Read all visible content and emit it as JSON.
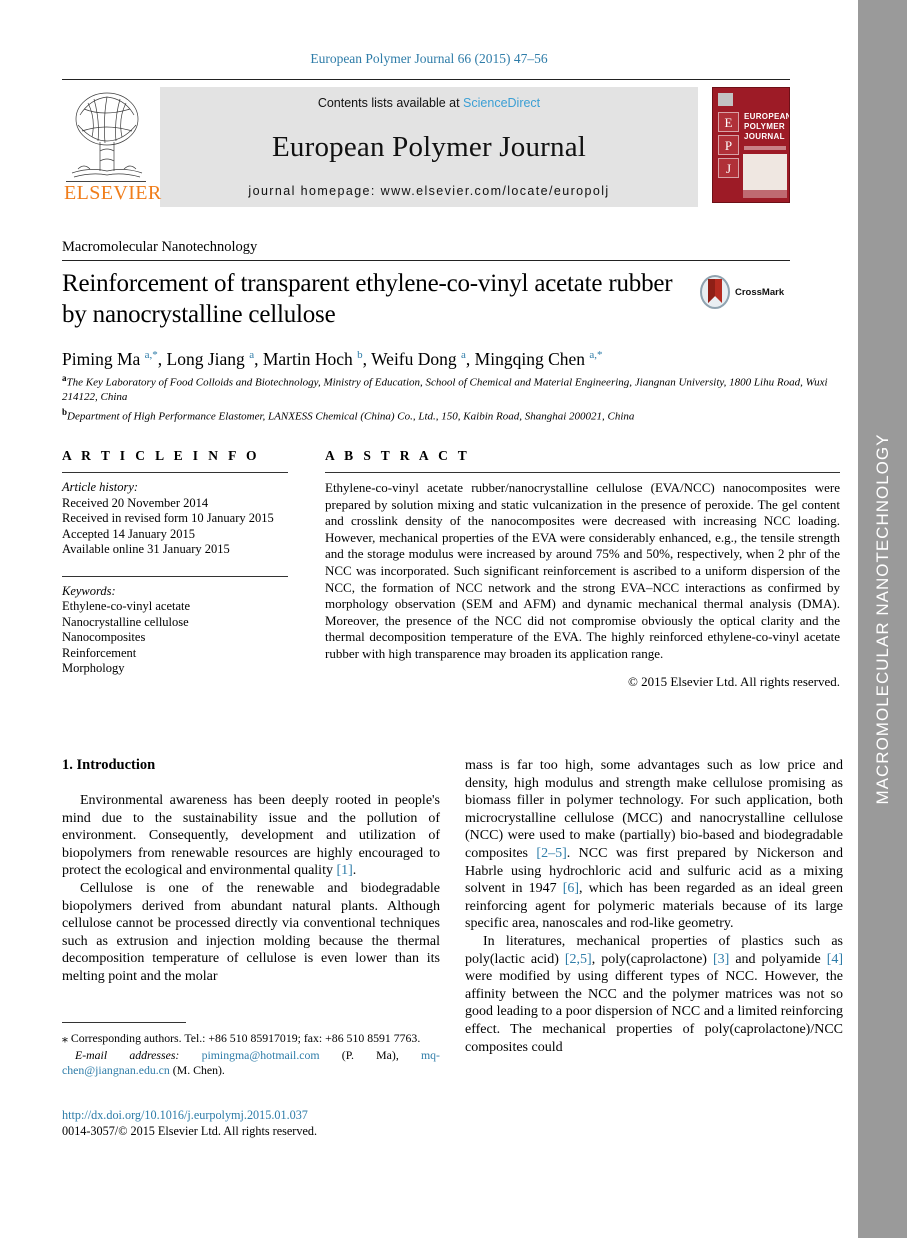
{
  "running_head": "European Polymer Journal 66 (2015) 47–56",
  "masthead": {
    "contents_prefix": "Contents lists available at ",
    "contents_link": "ScienceDirect",
    "journal_title": "European Polymer Journal",
    "homepage": "journal homepage: www.elsevier.com/locate/europolj",
    "publisher_name": "ELSEVIER",
    "cover": {
      "letters": [
        "E",
        "P",
        "J"
      ],
      "title_lines": [
        "EUROPEAN",
        "POLYMER",
        "JOURNAL"
      ]
    }
  },
  "side_band": {
    "label": "MACROMOLECULAR NANOTECHNOLOGY",
    "color": "#9a9a9a"
  },
  "section_label": "Macromolecular Nanotechnology",
  "title": "Reinforcement of transparent ethylene-co-vinyl acetate rubber by nanocrystalline cellulose",
  "crossmark": {
    "label": "CrossMark"
  },
  "authors": [
    {
      "name": "Piming Ma",
      "marks": "a,*"
    },
    {
      "name": "Long Jiang",
      "marks": "a"
    },
    {
      "name": "Martin Hoch",
      "marks": "b"
    },
    {
      "name": "Weifu Dong",
      "marks": "a"
    },
    {
      "name": "Mingqing Chen",
      "marks": "a,*"
    }
  ],
  "affiliations": [
    {
      "mark": "a",
      "text": "The Key Laboratory of Food Colloids and Biotechnology, Ministry of Education, School of Chemical and Material Engineering, Jiangnan University, 1800 Lihu Road, Wuxi 214122, China"
    },
    {
      "mark": "b",
      "text": "Department of High Performance Elastomer, LANXESS Chemical (China) Co., Ltd., 150, Kaibin Road, Shanghai 200021, China"
    }
  ],
  "article_info": {
    "heading": "A R T I C L E   I N F O",
    "history_label": "Article history:",
    "history": [
      "Received 20 November 2014",
      "Received in revised form 10 January 2015",
      "Accepted 14 January 2015",
      "Available online 31 January 2015"
    ],
    "keywords_label": "Keywords:",
    "keywords": [
      "Ethylene-co-vinyl acetate",
      "Nanocrystalline cellulose",
      "Nanocomposites",
      "Reinforcement",
      "Morphology"
    ]
  },
  "abstract": {
    "heading": "A B S T R A C T",
    "text": "Ethylene-co-vinyl acetate rubber/nanocrystalline cellulose (EVA/NCC) nanocomposites were prepared by solution mixing and static vulcanization in the presence of peroxide. The gel content and crosslink density of the nanocomposites were decreased with increasing NCC loading. However, mechanical properties of the EVA were considerably enhanced, e.g., the tensile strength and the storage modulus were increased by around 75% and 50%, respectively, when 2 phr of the NCC was incorporated. Such significant reinforcement is ascribed to a uniform dispersion of the NCC, the formation of NCC network and the strong EVA–NCC interactions as confirmed by morphology observation (SEM and AFM) and dynamic mechanical thermal analysis (DMA). Moreover, the presence of the NCC did not compromise obviously the optical clarity and the thermal decomposition temperature of the EVA. The highly reinforced ethylene-co-vinyl acetate rubber with high transparence may broaden its application range.",
    "copyright": "© 2015 Elsevier Ltd. All rights reserved."
  },
  "body": {
    "heading": "1. Introduction",
    "left_paragraphs": [
      "Environmental awareness has been deeply rooted in people's mind due to the sustainability issue and the pollution of environment. Consequently, development and utilization of biopolymers from renewable resources are highly encouraged to protect the ecological and environmental quality [1].",
      "Cellulose is one of the renewable and biodegradable biopolymers derived from abundant natural plants. Although cellulose cannot be processed directly via conventional techniques such as extrusion and injection molding because the thermal decomposition temperature of cellulose is even lower than its melting point and the molar"
    ],
    "right_paragraphs": [
      "mass is far too high, some advantages such as low price and density, high modulus and strength make cellulose promising as biomass filler in polymer technology. For such application, both microcrystalline cellulose (MCC) and nanocrystalline cellulose (NCC) were used to make (partially) bio-based and biodegradable composites [2–5]. NCC was first prepared by Nickerson and Habrle using hydrochloric acid and sulfuric acid as a mixing solvent in 1947 [6], which has been regarded as an ideal green reinforcing agent for polymeric materials because of its large specific area, nanoscales and rod-like geometry.",
      "In literatures, mechanical properties of plastics such as poly(lactic acid) [2,5], poly(caprolactone) [3] and polyamide [4] were modified by using different types of NCC. However, the affinity between the NCC and the polymer matrices was not so good leading to a poor dispersion of NCC and a limited reinforcing effect. The mechanical properties of poly(caprolactone)/NCC composites could"
    ]
  },
  "footnote": {
    "corresponding": "⁎ Corresponding authors. Tel.: +86 510 85917019; fax: +86 510 8591 7763.",
    "email_label": "E-mail addresses:",
    "emails": [
      {
        "address": "pimingma@hotmail.com",
        "owner": "(P. Ma)"
      },
      {
        "address": "mq-chen@jiangnan.edu.cn",
        "owner": "(M. Chen)"
      }
    ]
  },
  "doi": {
    "url": "http://dx.doi.org/10.1016/j.eurpolymj.2015.01.037",
    "issn_line": "0014-3057/© 2015 Elsevier Ltd. All rights reserved."
  },
  "colors": {
    "link": "#2e7ca8",
    "elsevier_orange": "#f07d1a",
    "band_gray": "#9a9a9a",
    "masthead_gray": "#e3e3e3",
    "cover_red": "#9d1b26"
  }
}
